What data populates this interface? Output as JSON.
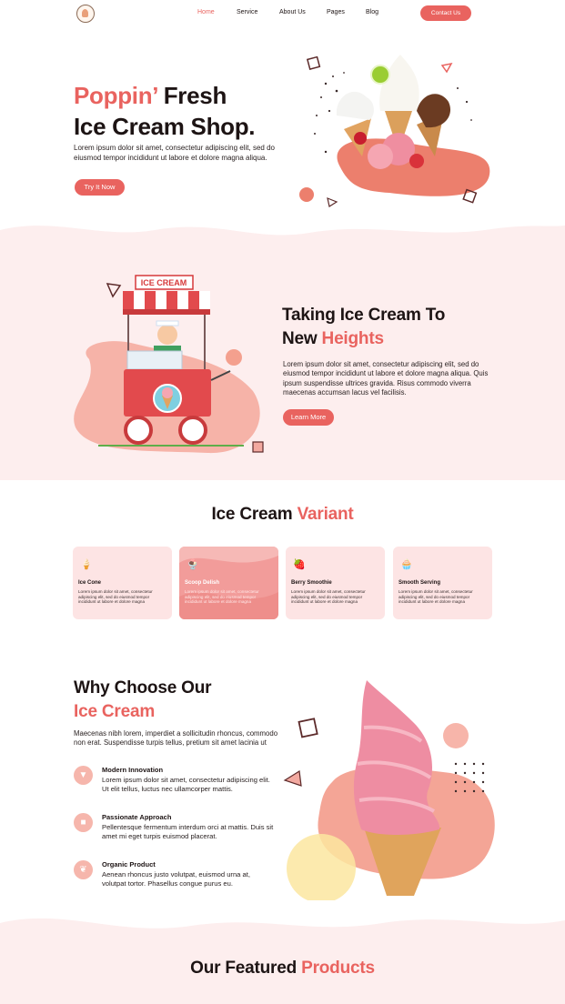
{
  "nav": {
    "links": [
      "Home",
      "Service",
      "About Us",
      "Pages",
      "Blog"
    ],
    "cta": "Contact Us"
  },
  "hero": {
    "title_accent": "Poppin’",
    "title_rest_1": " Fresh",
    "title_line2": "Ice Cream Shop.",
    "description": "Lorem ipsum dolor sit amet, consectetur adipiscing elit, sed do eiusmod tempor incididunt ut labore et dolore magna aliqua.",
    "button": "Try It Now"
  },
  "taking": {
    "title_line1": "Taking Ice Cream To",
    "title_line2_plain": "New ",
    "title_line2_accent": "Heights",
    "description": "Lorem ipsum dolor sit amet, consectetur adipiscing elit, sed do eiusmod tempor incididunt ut labore et dolore magna aliqua. Quis ipsum suspendisse ultrices gravida. Risus commodo viverra maecenas accumsan lacus vel facilisis.",
    "button": "Learn More",
    "cart_sign": "ICE CREAM"
  },
  "variants": {
    "title_plain": "Ice Cream ",
    "title_accent": "Variant",
    "items": [
      {
        "name": "Ice Cone",
        "icon": "ice-cone-icon",
        "glyph": "🍦",
        "text": "Lorem ipsum dolor sit amet, consectetur adipiscing elit, sed do eiusmod tempor incididunt ut labore et dolore magna"
      },
      {
        "name": "Scoop Delish",
        "icon": "scoop-icon",
        "glyph": "🍨",
        "text": "Lorem ipsum dolor sit amet, consectetur adipiscing elit, sed do eiusmod tempor incididunt ut labore et dolore magna"
      },
      {
        "name": "Berry Smoothie",
        "icon": "smoothie-icon",
        "glyph": "🍓",
        "text": "Lorem ipsum dolor sit amet, consectetur adipiscing elit, sed do eiusmod tempor incididunt ut labore et dolore magna"
      },
      {
        "name": "Smooth Serving",
        "icon": "cupcake-icon",
        "glyph": "🧁",
        "text": "Lorem ipsum dolor sit amet, consectetur adipiscing elit, sed do eiusmod tempor incididunt ut labore et dolore magna"
      }
    ]
  },
  "why": {
    "title_line1": "Why Choose Our",
    "title_line2": "Ice Cream",
    "description": "Maecenas nibh lorem, imperdiet a sollicitudin rhoncus, commodo non erat. Suspendisse turpis tellus, pretium sit amet lacinia ut",
    "features": [
      {
        "title": "Modern Innovation",
        "icon": "cone-icon",
        "text": "Lorem ipsum dolor sit amet, consectetur adipiscing elit. Ut elit tellus, luctus nec ullamcorper mattis."
      },
      {
        "title": "Passionate Approach",
        "icon": "graduation-cap-icon",
        "text": "Pellentesque fermentum interdum orci at mattis. Duis sit amet mi eget turpis euismod placerat."
      },
      {
        "title": "Organic Product",
        "icon": "leaf-icon",
        "text": "Aenean rhoncus justo volutpat, euismod urna at, volutpat tortor. Phasellus congue purus eu."
      }
    ]
  },
  "featured": {
    "title_plain": "Our Featured ",
    "title_accent": "Products"
  },
  "colors": {
    "accent": "#e9635f",
    "soft_pink": "#fde4e4",
    "dark_text": "#1d1414"
  }
}
